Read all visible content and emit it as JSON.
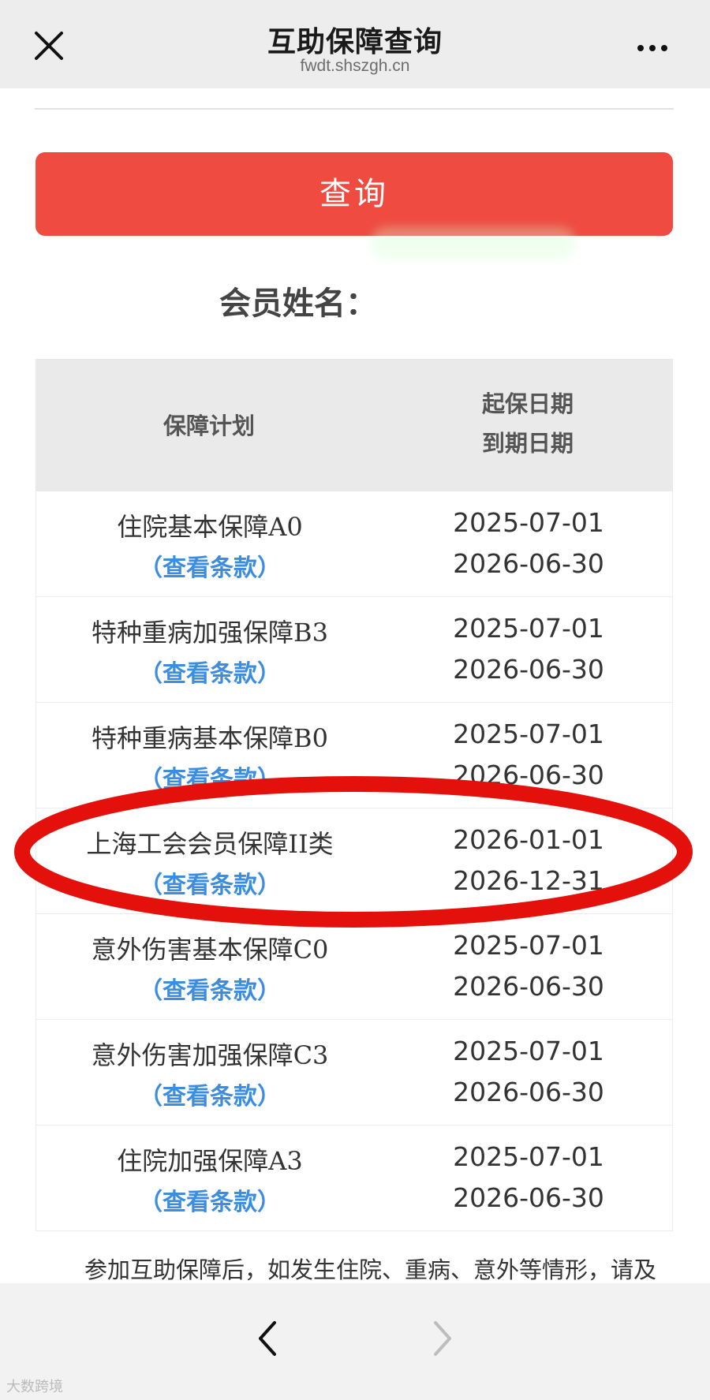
{
  "header": {
    "title": "互助保障查询",
    "subtitle": "fwdt.shszgh.cn"
  },
  "query_button": "查询",
  "member_label": "会员姓名：",
  "table": {
    "col_plan": "保障计划",
    "col_start": "起保日期",
    "col_end": "到期日期",
    "link_text": "（查看条款）",
    "rows": [
      {
        "plan": "住院基本保障A0",
        "start": "2025-07-01",
        "end": "2026-06-30"
      },
      {
        "plan": "特种重病加强保障B3",
        "start": "2025-07-01",
        "end": "2026-06-30"
      },
      {
        "plan": "特种重病基本保障B0",
        "start": "2025-07-01",
        "end": "2026-06-30"
      },
      {
        "plan": "上海工会会员保障II类",
        "start": "2026-01-01",
        "end": "2026-12-31"
      },
      {
        "plan": "意外伤害基本保障C0",
        "start": "2025-07-01",
        "end": "2026-06-30"
      },
      {
        "plan": "意外伤害加强保障C3",
        "start": "2025-07-01",
        "end": "2026-06-30"
      },
      {
        "plan": "住院加强保障A3",
        "start": "2025-07-01",
        "end": "2026-06-30"
      }
    ]
  },
  "highlight_color": "#e4100c",
  "notice": "参加互助保障后，如发生住院、重病、意外等情形，请及时向市职保中心（会）进行互助保障金的给付申请。",
  "watermark": "大数跨境"
}
